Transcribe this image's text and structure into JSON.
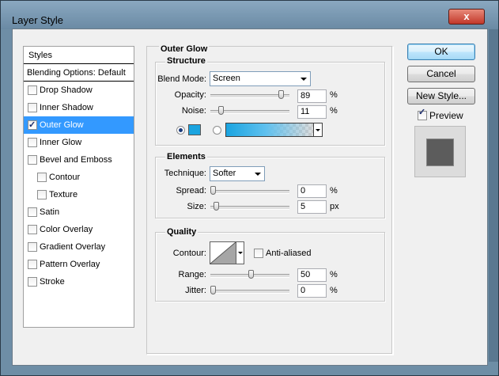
{
  "window": {
    "title": "Layer Style",
    "close_glyph": "x"
  },
  "styles_panel": {
    "header": "Styles",
    "blending": "Blending Options: Default",
    "items": [
      {
        "label": "Drop Shadow",
        "checked": false,
        "selected": false,
        "sub": false
      },
      {
        "label": "Inner Shadow",
        "checked": false,
        "selected": false,
        "sub": false
      },
      {
        "label": "Outer Glow",
        "checked": true,
        "selected": true,
        "sub": false
      },
      {
        "label": "Inner Glow",
        "checked": false,
        "selected": false,
        "sub": false
      },
      {
        "label": "Bevel and Emboss",
        "checked": false,
        "selected": false,
        "sub": false
      },
      {
        "label": "Contour",
        "checked": false,
        "selected": false,
        "sub": true
      },
      {
        "label": "Texture",
        "checked": false,
        "selected": false,
        "sub": true
      },
      {
        "label": "Satin",
        "checked": false,
        "selected": false,
        "sub": false
      },
      {
        "label": "Color Overlay",
        "checked": false,
        "selected": false,
        "sub": false
      },
      {
        "label": "Gradient Overlay",
        "checked": false,
        "selected": false,
        "sub": false
      },
      {
        "label": "Pattern Overlay",
        "checked": false,
        "selected": false,
        "sub": false
      },
      {
        "label": "Stroke",
        "checked": false,
        "selected": false,
        "sub": false
      }
    ]
  },
  "outer_glow": {
    "title": "Outer Glow",
    "structure": {
      "title": "Structure",
      "blend_mode_label": "Blend Mode:",
      "blend_mode_value": "Screen",
      "opacity_label": "Opacity:",
      "opacity_value": "89",
      "opacity_unit": "%",
      "noise_label": "Noise:",
      "noise_value": "11",
      "noise_unit": "%",
      "glow_color": "#1aa4e0"
    },
    "elements": {
      "title": "Elements",
      "technique_label": "Technique:",
      "technique_value": "Softer",
      "spread_label": "Spread:",
      "spread_value": "0",
      "spread_unit": "%",
      "size_label": "Size:",
      "size_value": "5",
      "size_unit": "px"
    },
    "quality": {
      "title": "Quality",
      "contour_label": "Contour:",
      "anti_aliased_label": "Anti-aliased",
      "range_label": "Range:",
      "range_value": "50",
      "range_unit": "%",
      "jitter_label": "Jitter:",
      "jitter_value": "0",
      "jitter_unit": "%"
    }
  },
  "buttons": {
    "ok": "OK",
    "cancel": "Cancel",
    "new_style": "New Style..."
  },
  "preview": {
    "label": "Preview",
    "checked": true
  }
}
